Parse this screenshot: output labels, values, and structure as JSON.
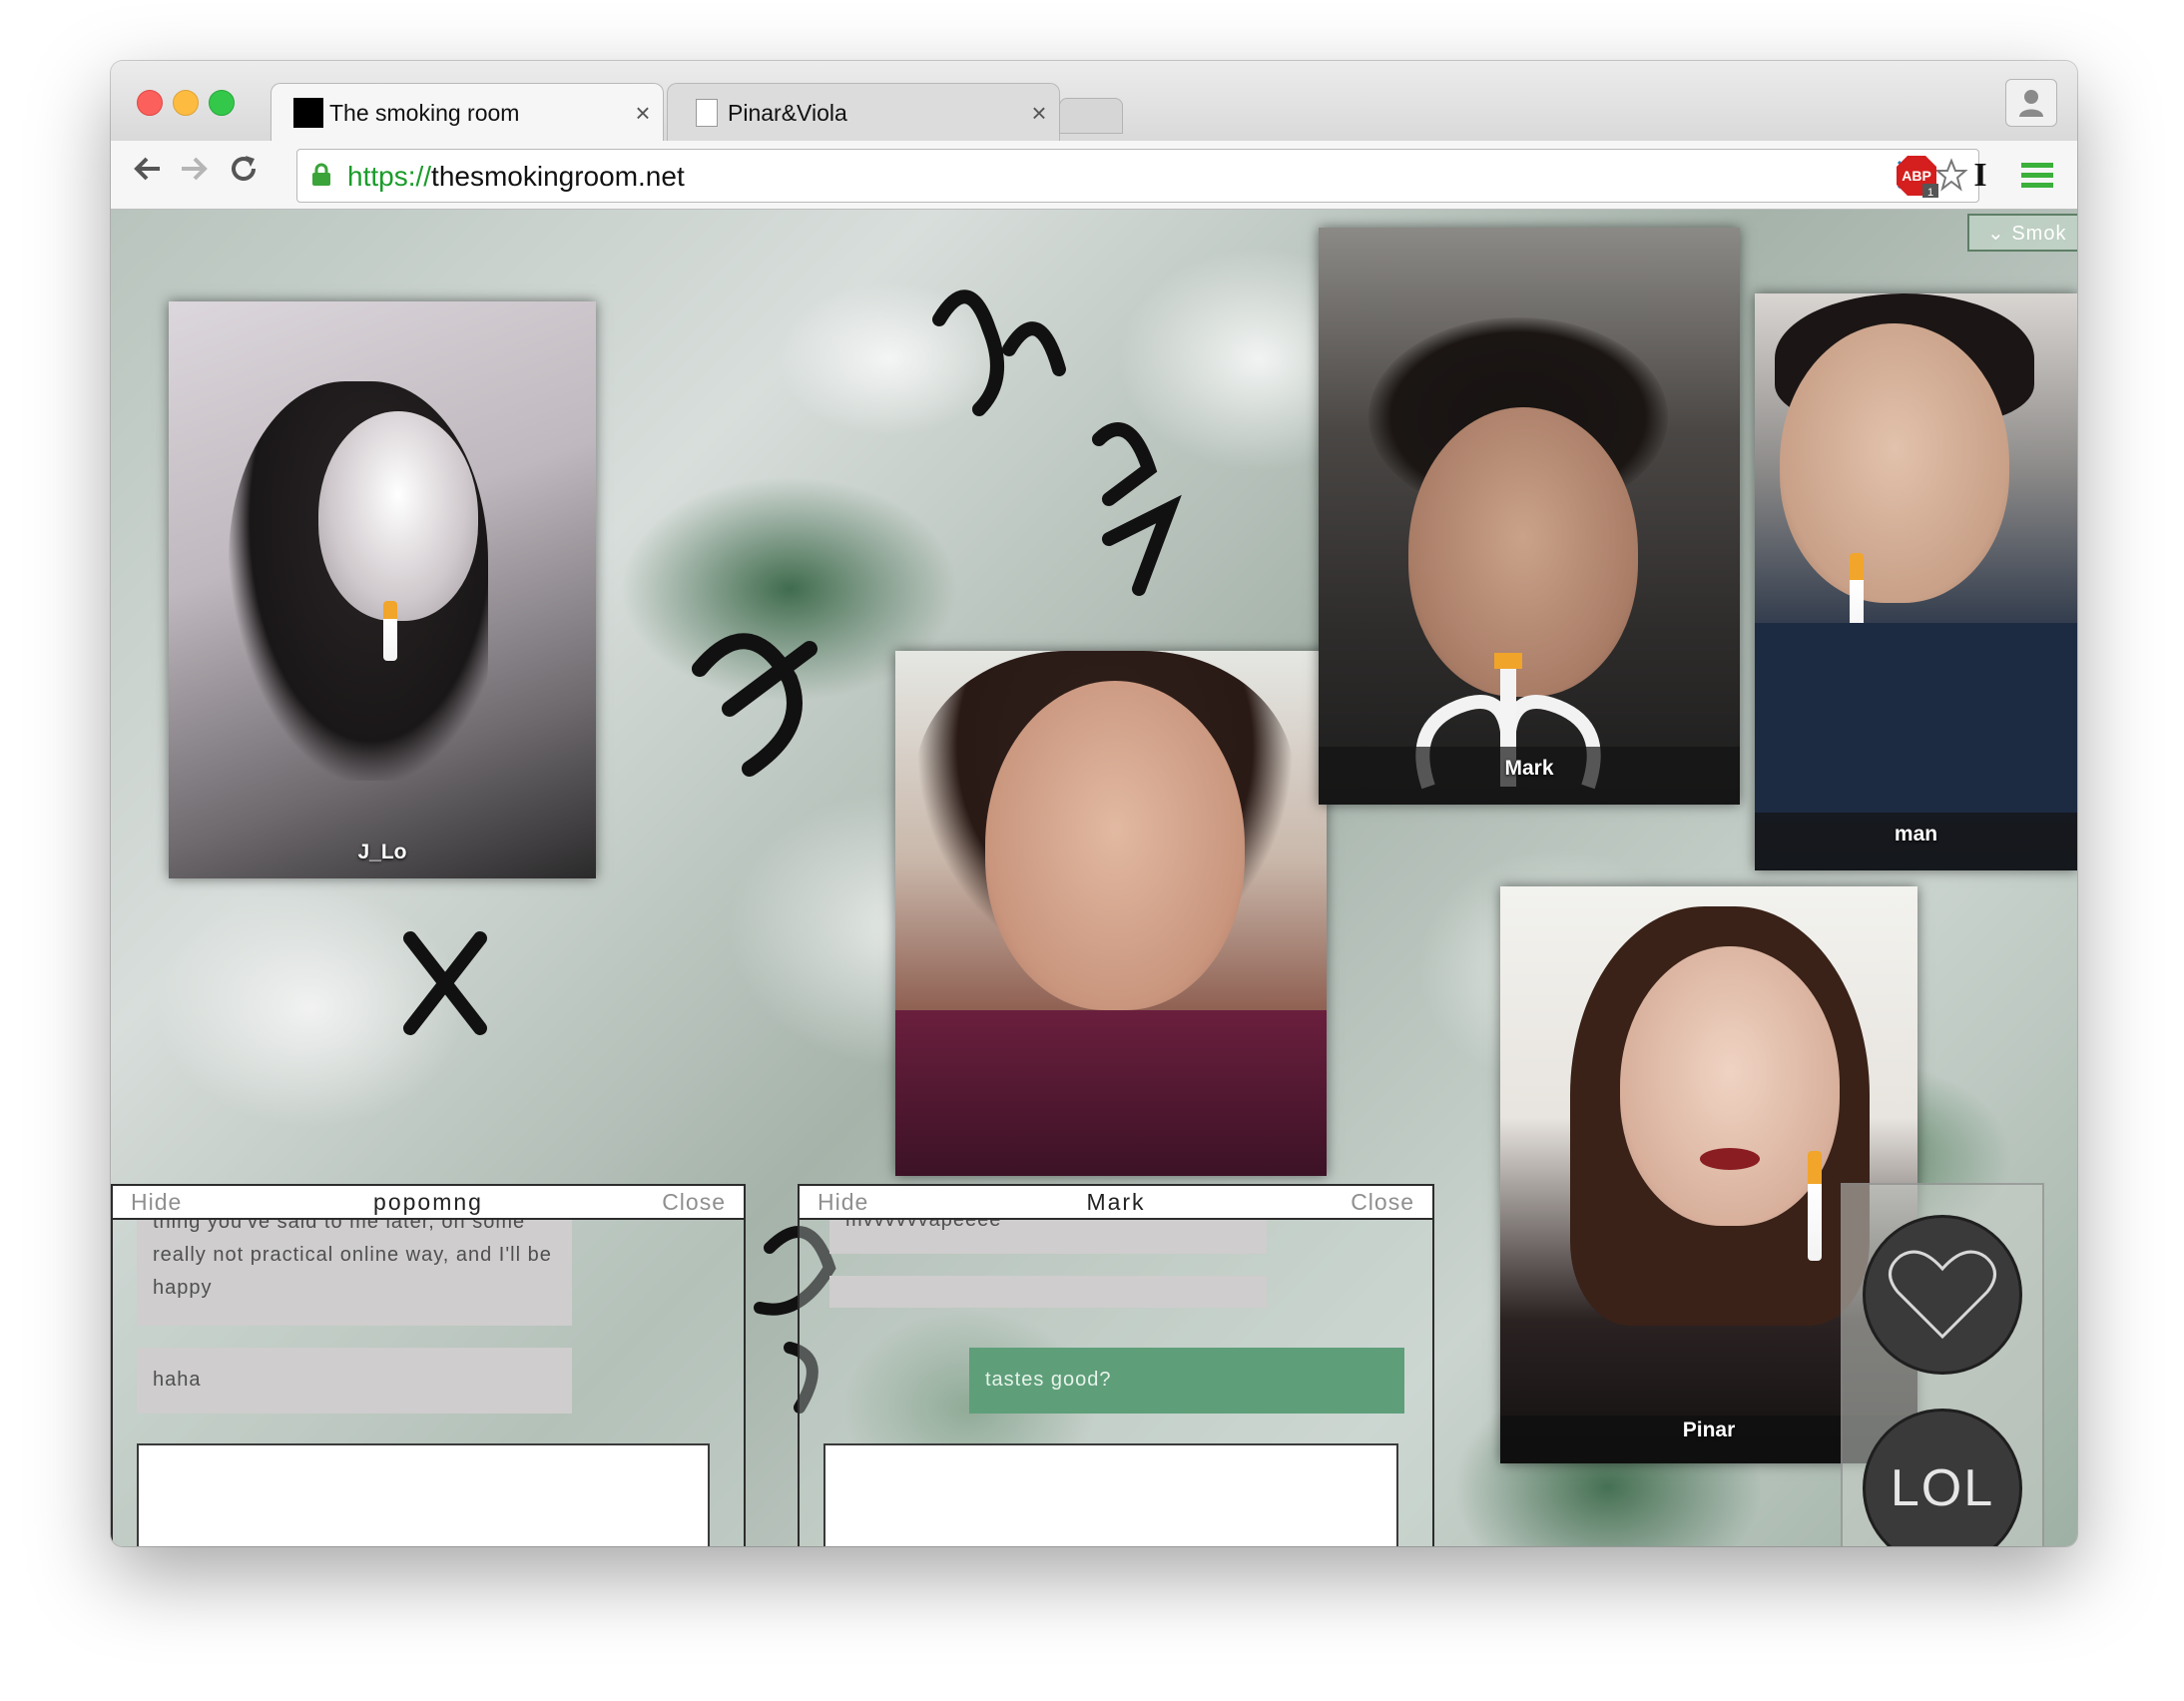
{
  "browser": {
    "tabs": [
      {
        "title": "The smoking room",
        "close": "×",
        "active": true
      },
      {
        "title": "Pinar&Viola",
        "close": "×",
        "active": false
      }
    ],
    "url": {
      "scheme": "https://",
      "host": "thesmokingroom.net"
    },
    "extensions": [
      "adblock-plus-icon",
      "instapaper-icon",
      "menu-icon"
    ],
    "adblock_label": "ABP",
    "adblock_count": "1",
    "instapaper_label": "I"
  },
  "page": {
    "top_right_tab": "⌄ Smok",
    "videos": [
      {
        "label": "J_Lo"
      },
      {
        "label": "Mark"
      },
      {
        "label": "man"
      },
      {
        "label": "Pinar"
      }
    ],
    "chats": [
      {
        "hide": "Hide",
        "name": "popomng",
        "close": "Close",
        "messages": [
          {
            "from": "other",
            "text": "thing you've said to me later, on some really not practical online way, and I'll be happy"
          },
          {
            "from": "other",
            "text": "haha"
          }
        ]
      },
      {
        "hide": "Hide",
        "name": "Mark",
        "close": "Close",
        "messages": [
          {
            "from": "other",
            "text": "mvvvvvvapeeee"
          },
          {
            "from": "other",
            "text": ""
          },
          {
            "from": "mine",
            "text": "tastes good?"
          }
        ]
      }
    ],
    "reactions": {
      "heart": "heart-icon",
      "lol": "LOL"
    }
  }
}
